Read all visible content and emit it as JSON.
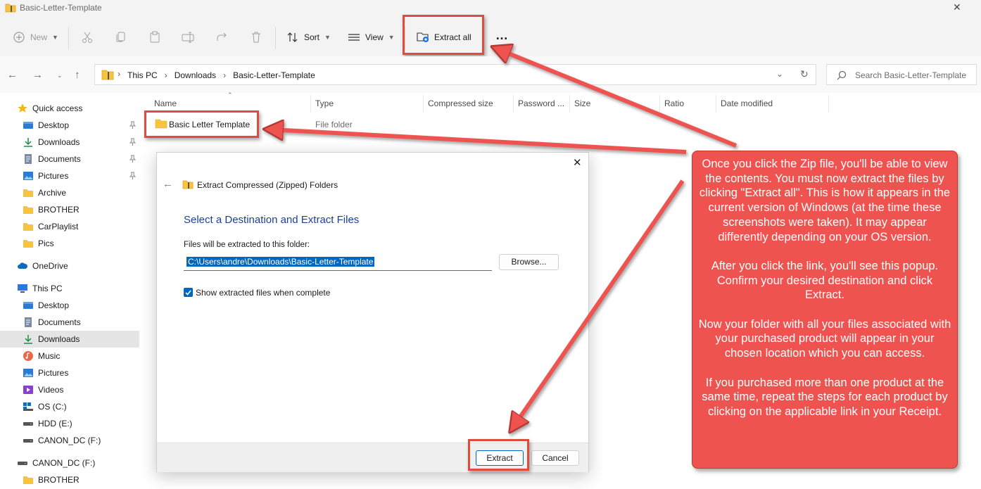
{
  "window": {
    "title": "Basic-Letter-Template"
  },
  "toolbar": {
    "new_label": "New",
    "sort_label": "Sort",
    "view_label": "View",
    "extract_all_label": "Extract all",
    "more_label": "…"
  },
  "address": {
    "crumbs": [
      "This PC",
      "Downloads",
      "Basic-Letter-Template"
    ],
    "search_placeholder": "Search Basic-Letter-Template"
  },
  "sidebar": {
    "quick_access": "Quick access",
    "quick_items": [
      {
        "label": "Desktop",
        "icon": "desktop-icon"
      },
      {
        "label": "Downloads",
        "icon": "download-icon"
      },
      {
        "label": "Documents",
        "icon": "documents-icon"
      },
      {
        "label": "Pictures",
        "icon": "pictures-icon"
      },
      {
        "label": "Archive",
        "icon": "folder-icon"
      },
      {
        "label": "BROTHER",
        "icon": "folder-icon"
      },
      {
        "label": "CarPlaylist",
        "icon": "folder-icon"
      },
      {
        "label": "Pics",
        "icon": "folder-icon"
      }
    ],
    "onedrive": "OneDrive",
    "this_pc": "This PC",
    "pc_items": [
      {
        "label": "Desktop",
        "icon": "desktop-icon"
      },
      {
        "label": "Documents",
        "icon": "documents-icon"
      },
      {
        "label": "Downloads",
        "icon": "download-icon"
      },
      {
        "label": "Music",
        "icon": "music-icon"
      },
      {
        "label": "Pictures",
        "icon": "pictures-icon"
      },
      {
        "label": "Videos",
        "icon": "videos-icon"
      },
      {
        "label": "OS (C:)",
        "icon": "windows-drive-icon"
      },
      {
        "label": "HDD (E:)",
        "icon": "drive-icon"
      },
      {
        "label": "CANON_DC (F:)",
        "icon": "drive-icon"
      }
    ],
    "canon": "CANON_DC (F:)",
    "brother": "BROTHER"
  },
  "filelist": {
    "columns": [
      "Name",
      "Type",
      "Compressed size",
      "Password ...",
      "Size",
      "Ratio",
      "Date modified"
    ],
    "rows": [
      {
        "name": "Basic Letter Template",
        "type": "File folder"
      }
    ]
  },
  "dialog": {
    "header_title": "Extract Compressed (Zipped) Folders",
    "heading": "Select a Destination and Extract Files",
    "path_label": "Files will be extracted to this folder:",
    "path_value": "C:\\Users\\andre\\Downloads\\Basic-Letter-Template",
    "browse_label": "Browse...",
    "checkbox_label": "Show extracted files when complete",
    "checkbox_checked": true,
    "extract_label": "Extract",
    "cancel_label": "Cancel"
  },
  "callout": {
    "text": "Once you click the Zip file, you'll be able to view the contents.  You must now extract the files by clicking \"Extract all\".  This is how it appears in the current version of Windows (at the time these screenshots were taken).  It may appear differently depending on your OS version.\n\nAfter you click the link, you'll see this popup.  Confirm your desired destination and click Extract.\n\nNow your folder with all your files associated with your purchased product will appear in your chosen location which you can access.\n\nIf you purchased more than one product at the same time, repeat the steps for each product by clicking on the applicable link in your Receipt."
  },
  "colors": {
    "accent": "#0067c0",
    "annotation": "#ef5350",
    "folder": "#f8c440"
  }
}
